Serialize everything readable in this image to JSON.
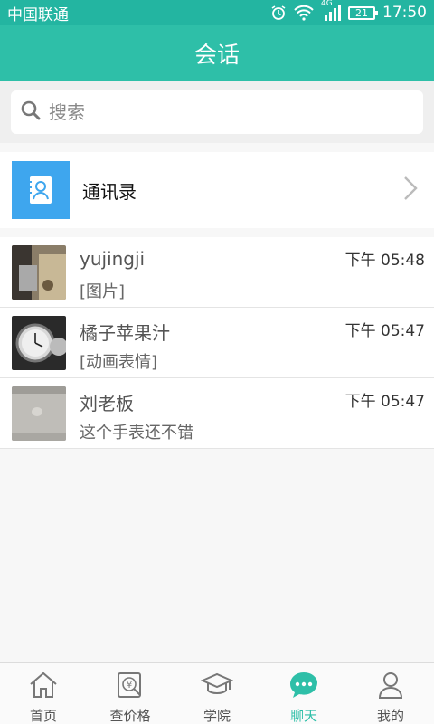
{
  "status_bar": {
    "carrier": "中国联通",
    "network": "4G",
    "battery": "21",
    "time": "17:50"
  },
  "header": {
    "title": "会话"
  },
  "search": {
    "placeholder": "搜索"
  },
  "contacts": {
    "label": "通讯录"
  },
  "conversations": [
    {
      "name": "yujingji",
      "message": "[图片]",
      "time": "下午 05:48"
    },
    {
      "name": "橘子苹果汁",
      "message": "[动画表情]",
      "time": "下午 05:47"
    },
    {
      "name": "刘老板",
      "message": "这个手表还不错",
      "time": "下午 05:47"
    }
  ],
  "tabs": [
    {
      "label": "首页",
      "icon": "home-icon"
    },
    {
      "label": "查价格",
      "icon": "price-icon"
    },
    {
      "label": "学院",
      "icon": "academy-icon"
    },
    {
      "label": "聊天",
      "icon": "chat-icon",
      "active": true
    },
    {
      "label": "我的",
      "icon": "profile-icon"
    }
  ],
  "colors": {
    "accent": "#2ebfa8",
    "status_bar": "#23b5a1",
    "contacts_icon_bg": "#3ea6ee"
  }
}
